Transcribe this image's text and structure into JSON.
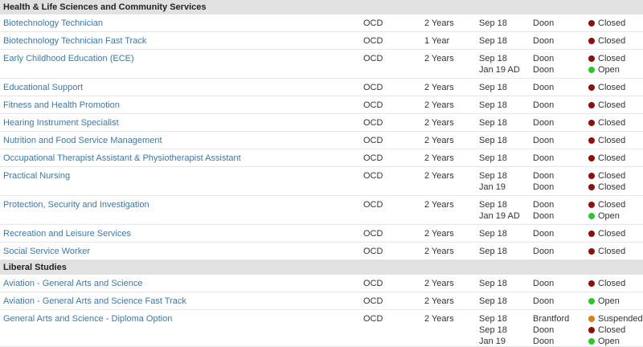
{
  "colors": {
    "closed": "#8b0f0f",
    "open": "#2ec52e",
    "suspended": "#d87e1d",
    "link": "#3d78a8",
    "section_bg": "#e1e1e1"
  },
  "sections": [
    {
      "title": "Health & Life Sciences and Community Services",
      "programs": [
        {
          "name": "Biotechnology Technician",
          "credential": "OCD",
          "duration": "2 Years",
          "intakes": [
            {
              "start": "Sep 18",
              "campus": "Doon",
              "status": "Closed"
            }
          ]
        },
        {
          "name": "Biotechnology Technician Fast Track",
          "credential": "OCD",
          "duration": "1 Year",
          "intakes": [
            {
              "start": "Sep 18",
              "campus": "Doon",
              "status": "Closed"
            }
          ]
        },
        {
          "name": "Early Childhood Education (ECE)",
          "credential": "OCD",
          "duration": "2 Years",
          "intakes": [
            {
              "start": "Sep 18",
              "campus": "Doon",
              "status": "Closed"
            },
            {
              "start": "Jan 19 AD",
              "campus": "Doon",
              "status": "Open"
            }
          ]
        },
        {
          "name": "Educational Support",
          "credential": "OCD",
          "duration": "2 Years",
          "intakes": [
            {
              "start": "Sep 18",
              "campus": "Doon",
              "status": "Closed"
            }
          ]
        },
        {
          "name": "Fitness and Health Promotion",
          "credential": "OCD",
          "duration": "2 Years",
          "intakes": [
            {
              "start": "Sep 18",
              "campus": "Doon",
              "status": "Closed"
            }
          ]
        },
        {
          "name": "Hearing Instrument Specialist",
          "credential": "OCD",
          "duration": "2 Years",
          "intakes": [
            {
              "start": "Sep 18",
              "campus": "Doon",
              "status": "Closed"
            }
          ]
        },
        {
          "name": "Nutrition and Food Service Management",
          "credential": "OCD",
          "duration": "2 Years",
          "intakes": [
            {
              "start": "Sep 18",
              "campus": "Doon",
              "status": "Closed"
            }
          ]
        },
        {
          "name": "Occupational Therapist Assistant & Physiotherapist Assistant",
          "credential": "OCD",
          "duration": "2 Years",
          "intakes": [
            {
              "start": "Sep 18",
              "campus": "Doon",
              "status": "Closed"
            }
          ]
        },
        {
          "name": "Practical Nursing",
          "credential": "OCD",
          "duration": "2 Years",
          "intakes": [
            {
              "start": "Sep 18",
              "campus": "Doon",
              "status": "Closed"
            },
            {
              "start": "Jan 19",
              "campus": "Doon",
              "status": "Closed"
            }
          ]
        },
        {
          "name": "Protection, Security and Investigation",
          "credential": "OCD",
          "duration": "2 Years",
          "intakes": [
            {
              "start": "Sep 18",
              "campus": "Doon",
              "status": "Closed"
            },
            {
              "start": "Jan 19 AD",
              "campus": "Doon",
              "status": "Open"
            }
          ]
        },
        {
          "name": "Recreation and Leisure Services",
          "credential": "OCD",
          "duration": "2 Years",
          "intakes": [
            {
              "start": "Sep 18",
              "campus": "Doon",
              "status": "Closed"
            }
          ]
        },
        {
          "name": "Social Service Worker",
          "credential": "OCD",
          "duration": "2 Years",
          "intakes": [
            {
              "start": "Sep 18",
              "campus": "Doon",
              "status": "Closed"
            }
          ]
        }
      ]
    },
    {
      "title": "Liberal Studies",
      "programs": [
        {
          "name": "Aviation - General Arts and Science",
          "credential": "OCD",
          "duration": "2 Years",
          "intakes": [
            {
              "start": "Sep 18",
              "campus": "Doon",
              "status": "Closed"
            }
          ]
        },
        {
          "name": "Aviation - General Arts and Science Fast Track",
          "credential": "OCD",
          "duration": "2 Years",
          "intakes": [
            {
              "start": "Sep 18",
              "campus": "Doon",
              "status": "Open"
            }
          ]
        },
        {
          "name": "General Arts and Science - Diploma Option",
          "credential": "OCD",
          "duration": "2 Years",
          "intakes": [
            {
              "start": "Sep 18",
              "campus": "Brantford",
              "status": "Suspended"
            },
            {
              "start": "Sep 18",
              "campus": "Doon",
              "status": "Closed"
            },
            {
              "start": "Jan 19",
              "campus": "Doon",
              "status": "Open"
            }
          ]
        }
      ]
    }
  ]
}
